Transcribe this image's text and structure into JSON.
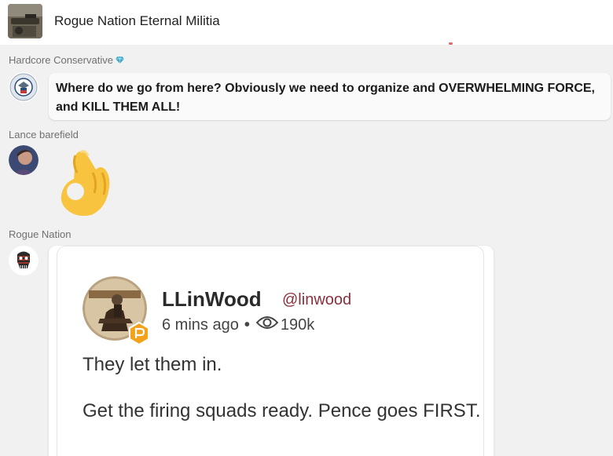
{
  "channel": {
    "title": "Rogue Nation Eternal Militia",
    "avatar_icon": "channel-photo-icon"
  },
  "messages": [
    {
      "sender": "Hardcore Conservative",
      "sender_badge_icon": "diamond-icon",
      "avatar_icon": "dhs-seal-icon",
      "text": "Where do we go from here? Obviously we need to organize and OVERWHELMING FORCE, and KILL THEM ALL!"
    },
    {
      "sender": "Lance barefield",
      "avatar_icon": "user-photo-icon",
      "sticker_icon": "ok-hand-emoji-icon"
    },
    {
      "sender": "Rogue Nation",
      "avatar_icon": "punisher-skull-icon",
      "attachment": {
        "type": "screenshot",
        "post": {
          "author_name": "LLinWood",
          "author_handle": "@linwood",
          "time": "6 mins ago",
          "views": "190k",
          "body_line1": "They let them in.",
          "body_line2": "Get the firing squads ready. Pence goes FIRST."
        }
      }
    }
  ],
  "colors": {
    "background": "#f1f1f1",
    "handle": "#8a2f3c",
    "parler_badge": "#f2a21b",
    "gem": "#3aa6c8"
  }
}
